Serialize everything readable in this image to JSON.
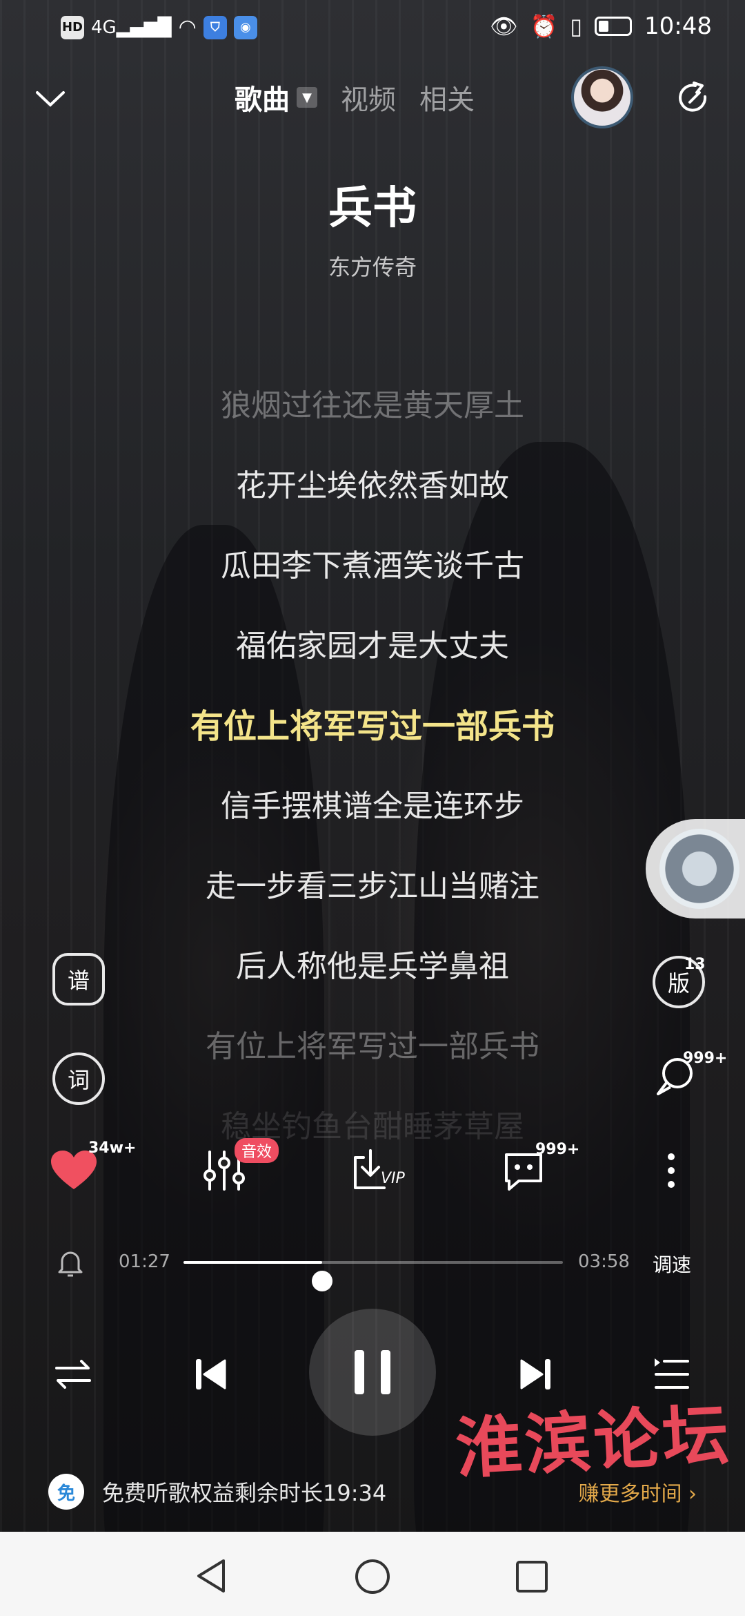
{
  "status_bar": {
    "left_icons": [
      "HD",
      "4G",
      "signal",
      "wifi",
      "shield-app",
      "globe-app"
    ],
    "time": "10:48"
  },
  "top_bar": {
    "tabs": [
      {
        "label": "歌曲",
        "active": true
      },
      {
        "label": "视频",
        "active": false
      },
      {
        "label": "相关",
        "active": false
      }
    ]
  },
  "song": {
    "title": "兵书",
    "artist": "东方传奇"
  },
  "lyrics": [
    {
      "text": "狼烟过往还是黄天厚土",
      "state": "dim"
    },
    {
      "text": "花开尘埃依然香如故",
      "state": "normal"
    },
    {
      "text": "瓜田李下煮酒笑谈千古",
      "state": "normal"
    },
    {
      "text": "福佑家园才是大丈夫",
      "state": "normal"
    },
    {
      "text": "有位上将军写过一部兵书",
      "state": "current"
    },
    {
      "text": "信手摆棋谱全是连环步",
      "state": "normal"
    },
    {
      "text": "走一步看三步江山当赌注",
      "state": "normal"
    },
    {
      "text": "后人称他是兵学鼻祖",
      "state": "normal"
    },
    {
      "text": "有位上将军写过一部兵书",
      "state": "dim"
    },
    {
      "text": "稳坐钓鱼台酣睡茅草屋",
      "state": "faint"
    }
  ],
  "side_tools": {
    "score_label": "谱",
    "lyric_label": "词",
    "version_label": "版",
    "version_count": "13",
    "comment_count": "999+"
  },
  "actions": {
    "like_count": "34w+",
    "effect_badge": "音效",
    "download_label": "VIP",
    "comments_count": "999+"
  },
  "progress": {
    "elapsed": "01:27",
    "total": "03:58",
    "fraction": 0.365,
    "speed_label": "调速"
  },
  "watermark": "淮滨论坛",
  "free_listen": {
    "icon_label": "免",
    "text": "免费听歌权益剩余时长19:34",
    "more": "赚更多时间"
  },
  "colors": {
    "current_lyric": "#f4e48a",
    "like": "#f05060",
    "badge": "#ef4d61",
    "more_link": "#e3a94a"
  }
}
